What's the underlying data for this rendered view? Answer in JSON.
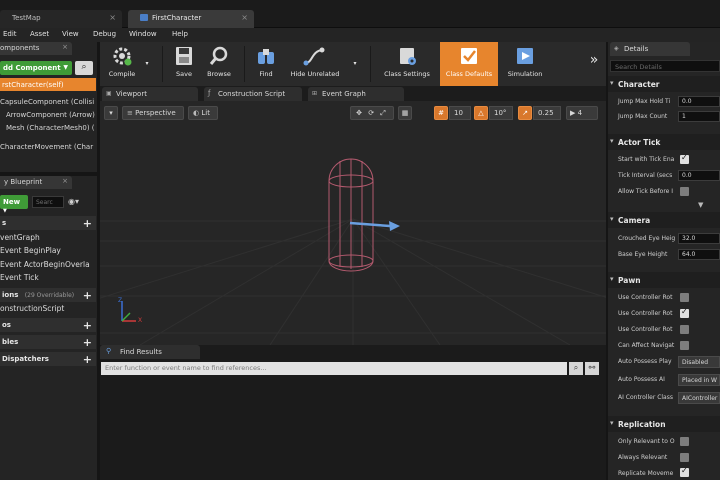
{
  "tabs": {
    "testmap": "TestMap",
    "firstcharacter": "FirstCharacter"
  },
  "menu": [
    "Edit",
    "Asset",
    "View",
    "Debug",
    "Window",
    "Help"
  ],
  "components": {
    "tab_label": "omponents",
    "add_button": "dd Component",
    "items": [
      "CapsuleComponent (Collisi",
      "ArrowComponent (Arrow)",
      "Mesh (CharacterMesh0) (",
      "CharacterMovement (Char"
    ],
    "self_label": "rstCharacter(self)"
  },
  "my_blueprint": {
    "tab_label": "y Blueprint",
    "new_button": "New",
    "search_placeholder": "Searc",
    "sections": {
      "graphs": "s",
      "functions": "ions",
      "functions_overridable": "(29 Overridable)",
      "macros": "os",
      "variables": "bles",
      "dispatchers": " Dispatchers"
    },
    "graph_items": [
      "ventGraph",
      "Event BeginPlay",
      "Event ActorBeginOverla",
      "Event Tick"
    ],
    "function_items": [
      "onstructionScript"
    ]
  },
  "toolbar": {
    "compile": "Compile",
    "save": "Save",
    "browse": "Browse",
    "find": "Find",
    "hide_unrelated": "Hide Unrelated",
    "class_settings": "Class Settings",
    "class_defaults": "Class Defaults",
    "simulation": "Simulation"
  },
  "editor_tabs": {
    "viewport": "Viewport",
    "construction_script": "Construction Script",
    "event_graph": "Event Graph"
  },
  "viewport": {
    "perspective": "Perspective",
    "lit": "Lit",
    "grid_snap": "10",
    "rotation_snap": "10°",
    "scale_snap": "0.25",
    "camera_speed": "4",
    "axis_z": "Z",
    "axis_x": "X"
  },
  "find_results": {
    "tab_label": "Find Results",
    "placeholder": "Enter function or event name to find references..."
  },
  "details": {
    "tab_label": "Details",
    "search_placeholder": "Search Details",
    "categories": {
      "character": "Character",
      "actor_tick": "Actor Tick",
      "camera": "Camera",
      "pawn": "Pawn",
      "replication": "Replication"
    },
    "character": {
      "jump_hold_label": "Jump Max Hold Ti",
      "jump_hold_value": "0.0",
      "jump_count_label": "Jump Max Count",
      "jump_count_value": "1"
    },
    "actor_tick": {
      "start_tick_label": "Start with Tick Ena",
      "start_tick_checked": true,
      "tick_interval_label": "Tick Interval (secs",
      "tick_interval_value": "0.0",
      "allow_tick_label": "Allow Tick Before I",
      "allow_tick_checked": false
    },
    "camera": {
      "crouched_label": "Crouched Eye Heig",
      "crouched_value": "32.0",
      "base_label": "Base Eye Height",
      "base_value": "64.0"
    },
    "pawn": {
      "rows": [
        {
          "label": "Use Controller Rot",
          "checked": false
        },
        {
          "label": "Use Controller Rot",
          "checked": true
        },
        {
          "label": "Use Controller Rot",
          "checked": false
        },
        {
          "label": "Can Affect Navigat",
          "checked": false
        }
      ],
      "auto_possess_player_label": "Auto Possess Play",
      "auto_possess_player_value": "Disabled",
      "auto_possess_ai_label": "Auto Possess AI",
      "auto_possess_ai_value": "Placed in W",
      "ai_controller_label": "AI Controller Class",
      "ai_controller_value": "AIController"
    },
    "replication": {
      "rows": [
        {
          "label": "Only Relevant to O",
          "checked": false
        },
        {
          "label": "Always Relevant",
          "checked": false
        },
        {
          "label": "Replicate Moveme",
          "checked": true
        }
      ]
    }
  },
  "colors": {
    "accent_orange": "#e7852d",
    "green_button": "#3f9b37",
    "capsule": "#b35a6e",
    "arrow": "#6a9fe0"
  }
}
